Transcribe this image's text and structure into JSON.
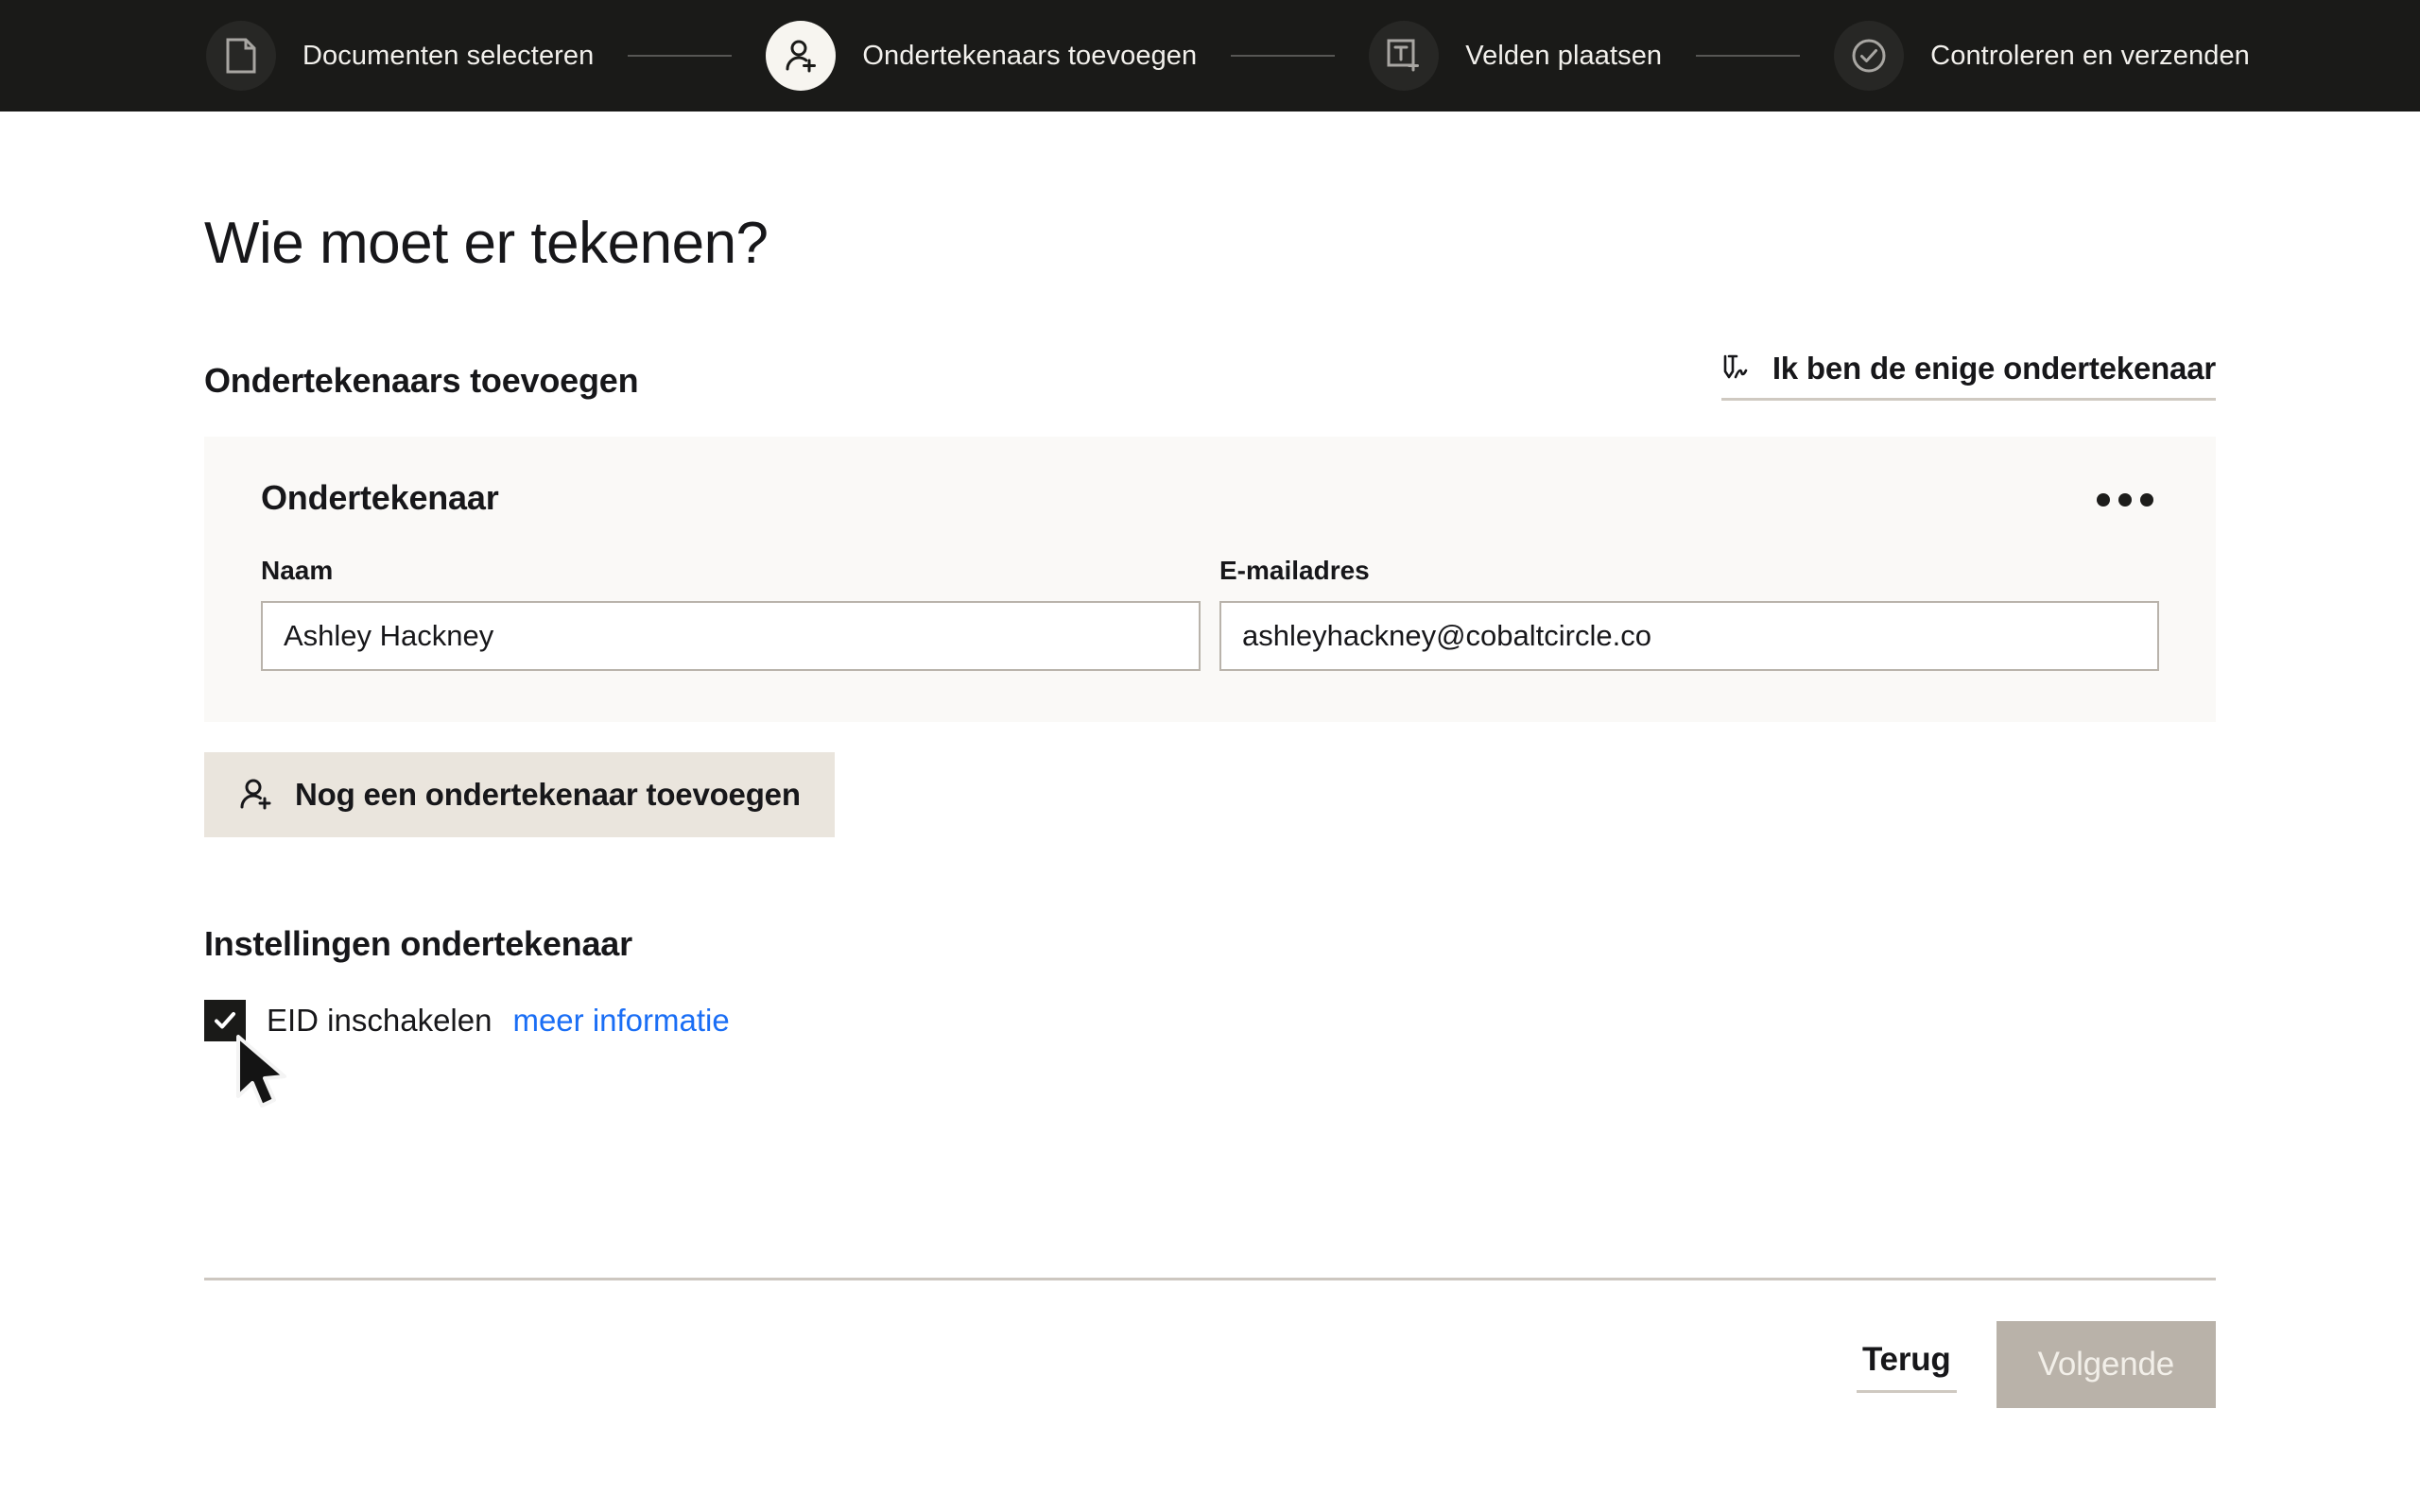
{
  "stepper": {
    "steps": [
      {
        "label": "Documenten selecteren",
        "icon": "document-icon",
        "state": "inactive"
      },
      {
        "label": "Ondertekenaars toevoegen",
        "icon": "person-add-icon",
        "state": "active"
      },
      {
        "label": "Velden plaatsen",
        "icon": "text-field-add-icon",
        "state": "inactive"
      },
      {
        "label": "Controleren en verzenden",
        "icon": "check-circle-icon",
        "state": "inactive"
      }
    ]
  },
  "page": {
    "title": "Wie moet er tekenen?"
  },
  "signers_section": {
    "heading": "Ondertekenaars toevoegen",
    "only_signer_label": "Ik ben de enige ondertekenaar",
    "only_signer_icon": "signature-pen-icon"
  },
  "signer_card": {
    "title": "Ondertekenaar",
    "menu_icon": "more-options-icon",
    "name_label": "Naam",
    "name_value": "Ashley Hackney",
    "name_placeholder": "Naam",
    "email_label": "E-mailadres",
    "email_value": "ashleyhackney@cobaltcircle.co",
    "email_placeholder": "E-mailadres"
  },
  "add_signer": {
    "label": "Nog een ondertekenaar toevoegen",
    "icon": "person-add-icon"
  },
  "settings": {
    "heading": "Instellingen ondertekenaar",
    "eid_label": "EID inschakelen",
    "eid_link": "meer informatie",
    "eid_checked": true
  },
  "footer": {
    "back_label": "Terug",
    "next_label": "Volgende",
    "next_disabled": true
  },
  "colors": {
    "header_bg": "#1a1a18",
    "card_bg": "#faf9f7",
    "accent_button_bg": "#eae5dd",
    "link_blue": "#1a6ef5",
    "disabled_button_bg": "#b9b2a9",
    "divider": "#cdc7c0"
  }
}
